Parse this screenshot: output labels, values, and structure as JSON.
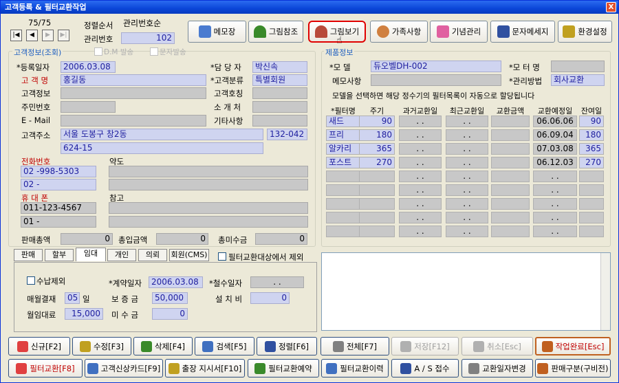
{
  "window": {
    "title": "고객등록 & 필터교환작업",
    "close": "X"
  },
  "record": {
    "counter": "75/75",
    "sort_label": "정렬순서",
    "sort_value": "관리번호순",
    "mgmt_label": "관리번호",
    "mgmt_value": "102"
  },
  "nav": {
    "first": "|◀",
    "prev": "◀",
    "next": "▶",
    "last": "▶|"
  },
  "toolbar": {
    "memo": "메모장",
    "pic_ref": "그림참조",
    "pic_view": "그림보기",
    "family": "가족사항",
    "anniv": "기념관리",
    "sms": "문자메세지",
    "settings": "환경설정"
  },
  "customer": {
    "group_title": "고객정보(조회)",
    "dm_label": "D.M 발송",
    "sms_label": "문자발송",
    "reg_date_label": "*등록일자",
    "reg_date": "2006.03.08",
    "name_label": "고 객 명",
    "name": "홍길동",
    "info_label": "고객정보",
    "info": "",
    "id_label": "주민번호",
    "id": "",
    "email_label": "E - Mail",
    "email": "",
    "addr_label": "고객주소",
    "addr1": "서울 도봉구 창2동",
    "zip": "132-042",
    "addr2": "624-15",
    "manager_label": "*담 당 자",
    "manager": "박신속",
    "class_label": "*고객분류",
    "class": "특별회원",
    "title_label": "고객호칭",
    "title": "",
    "ref_label": "소 개 처",
    "ref": "",
    "etc_label": "기타사항",
    "etc": "",
    "phone_label": "전화번호",
    "phone1": "02  -998-5303",
    "phone2": "02  -",
    "mobile_label": "휴 대 폰",
    "mobile1": "011-123-4567",
    "mobile2": "01 -",
    "map_label": "약도",
    "note_label": "참고"
  },
  "sales": {
    "total_label": "판매총액",
    "total": "0",
    "paid_label": "총입금액",
    "paid": "0",
    "unpaid_label": "총미수금",
    "unpaid": "0"
  },
  "tabs": [
    "판매",
    "할부",
    "임대",
    "개인",
    "의뢰",
    "회원(CMS)"
  ],
  "exclude_label": "필터교환대상에서 제외",
  "rental": {
    "exclude_payment": "수납제외",
    "contract_label": "*계약일자",
    "contract": "2006.03.08",
    "withdraw_label": "*철수일자",
    "withdraw": ". .",
    "pay_label": "매월결재",
    "pay_day": "05",
    "pay_unit": "일",
    "deposit_label": "보 증 금",
    "deposit": "50,000",
    "install_label": "설 치 비",
    "install": "0",
    "fee_label": "월임대료",
    "fee": "15,000",
    "unpaid_label": "미 수 금",
    "unpaid": "0"
  },
  "equipment": {
    "group_title": "제품정보",
    "model_label": "*모    델",
    "model": "듀오벨DH-002",
    "motor_label": "*모 터 명",
    "motor": "",
    "memo_label": "메모사항",
    "memo": "",
    "method_label": "*관리방법",
    "method": "회사교환",
    "hint": "모델을 선택하면 해당 정수기의 필터목록이 자동으로 할당됩니다"
  },
  "filter_table": {
    "headers": [
      "*필터명",
      "주기",
      "과거교환일",
      "최근교환일",
      "교환금액",
      "교환예정일",
      "잔여일"
    ],
    "rows": [
      [
        "새드",
        "90",
        ". .",
        ". .",
        "",
        "06.06.06",
        "90"
      ],
      [
        "프리",
        "180",
        ". .",
        ". .",
        "",
        "06.09.04",
        "180"
      ],
      [
        "알카리",
        "365",
        ". .",
        ". .",
        "",
        "07.03.08",
        "365"
      ],
      [
        "포스트",
        "270",
        ". .",
        ". .",
        "",
        "06.12.03",
        "270"
      ],
      [
        "",
        "",
        ". .",
        ". .",
        "",
        ". .",
        ""
      ],
      [
        "",
        "",
        ". .",
        ". .",
        "",
        ". .",
        ""
      ],
      [
        "",
        "",
        ". .",
        ". .",
        "",
        ". .",
        ""
      ],
      [
        "",
        "",
        ". .",
        ". .",
        "",
        ". .",
        ""
      ],
      [
        "",
        "",
        ". .",
        ". .",
        "",
        ". .",
        ""
      ]
    ]
  },
  "buttons_row1": [
    "신규[F2]",
    "수정[F3]",
    "삭제[F4]",
    "검색[F5]",
    "정렬[F6]",
    "전체[F7]",
    "저장[F12]",
    "취소[Esc]",
    "작업완료[Esc]"
  ],
  "buttons_row2": [
    "필터교환[F8]",
    "고객신상카드[F9]",
    "출장 지시서[F10]",
    "필터교환예약",
    "필터교환이력",
    "A / S 접수",
    "교환일자변경",
    "판매구분(구비전)"
  ],
  "colors": {
    "title_bar": "#0a46d8",
    "field_blue": "#cfd4f0",
    "text_blue": "#2020a0",
    "label_red": "#c00000",
    "highlight": "#e00000"
  }
}
